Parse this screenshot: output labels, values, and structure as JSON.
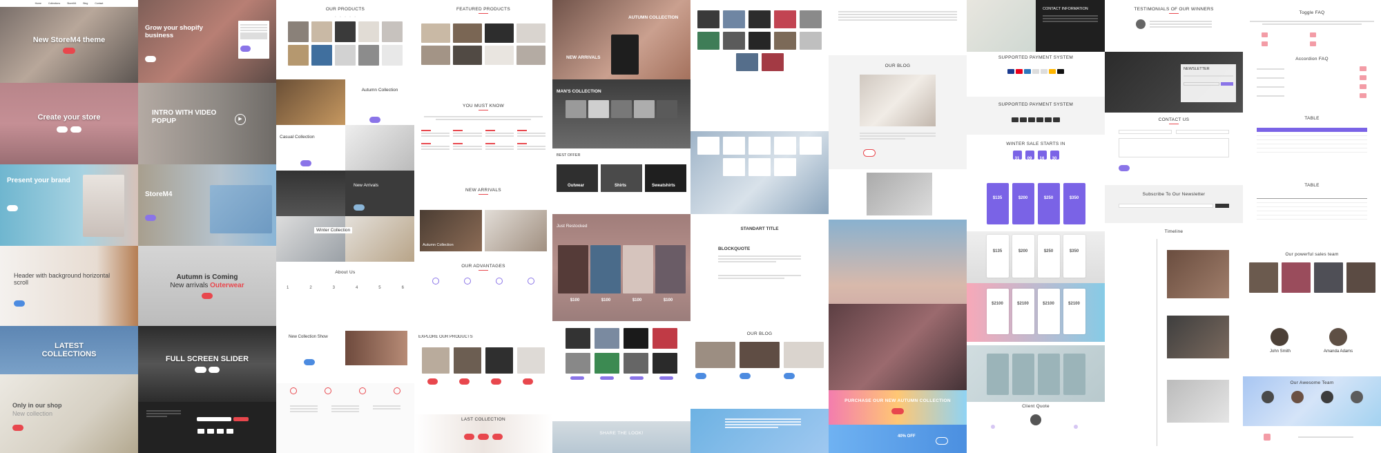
{
  "col1": {
    "nav": [
      "Home",
      "Collections",
      "StoreM4",
      "Blog",
      "Contact"
    ],
    "hero1_title": "New StoreM4 theme",
    "hero2_title": "Create your store",
    "hero3_title": "Present your brand",
    "hero4_title": "Header with background horizontal scroll",
    "hero5_title": "LATEST COLLECTIONS",
    "hero6_title": "Only in our shop",
    "hero6_sub": "New collection"
  },
  "col2": {
    "hero1_title": "Grow your shopify business",
    "hero2_title": "INTRO WITH VIDEO POPUP",
    "hero3_title": "StoreM4",
    "hero4_title": "Autumn is Coming",
    "hero4_sub_a": "New arrivals",
    "hero4_sub_b": "Outerwear",
    "hero5_title": "FULL SCREEN SLIDER"
  },
  "col3": {
    "our_products": "OUR PRODUCTS",
    "autumn": "Autumn Collection",
    "casual": "Casual Collection",
    "new_arrivals": "New Arrivals",
    "winter": "Winter Collection",
    "about": "About Us",
    "about_nums": [
      "1",
      "2",
      "3",
      "4",
      "5",
      "6"
    ],
    "new_show": "New Collection Show"
  },
  "col4": {
    "featured": "FEATURED PRODUCTS",
    "you_must_know": "YOU MUST KNOW",
    "new_arrivals": "NEW ARRIVALS",
    "autumn_collection": "Autumn Collection",
    "advantages": "OUR ADVANTAGES",
    "explore": "EXPLORE OUR PRODUCTS",
    "last": "LAST COLLECTION"
  },
  "col5": {
    "autumn": "AUTUMN COLLECTION",
    "new_arrivals": "NEW ARRIVALS",
    "mans": "MAN'S COLLECTION",
    "best_offer": "BEST OFFER",
    "offer_labels": [
      "Outwear",
      "Shirts",
      "Sweatshirts"
    ],
    "just_restocked": "Just Restocked",
    "prices": [
      "$100",
      "$100",
      "$100",
      "$100"
    ],
    "share": "SHARE THE LOOK!"
  },
  "col6": {
    "standart": "STANDART TITLE",
    "blockquote": "BLOCKQUOTE",
    "blog": "OUR BLOG"
  },
  "col7": {
    "blog": "OUR BLOG",
    "purchase": "PURCHASE OUR NEW AUTUMN COLLECTION",
    "off": "40% OFF"
  },
  "col8": {
    "contact": "CONTACT INFORMATION",
    "payment1": "SUPPORTED PAYMENT SYSTEM",
    "payment2": "SUPPORTED PAYMENT SYSTEM",
    "winter_sale": "WINTER SALE STARTS IN",
    "countdown": [
      "31",
      "09",
      "16",
      "30"
    ],
    "prices_a": [
      "$135",
      "$200",
      "$250",
      "$350"
    ],
    "prices_b": [
      "$135",
      "$200",
      "$250",
      "$350"
    ],
    "prices_c": [
      "$2100",
      "$2100",
      "$2100",
      "$2100"
    ],
    "client_quote": "Client Quote"
  },
  "col9": {
    "testimonials": "TESTIMONIALS OF OUR WINNERS",
    "newsletter": "NEWSLETTER",
    "contact_us": "CONTACT US",
    "subscribe": "Subscribe To Our Newsletter",
    "timeline": "Timeline"
  },
  "col10": {
    "toggle_faq": "Toggle FAQ",
    "accordion_faq": "Accordion FAQ",
    "table1": "TABLE",
    "table2": "TABLE",
    "sales_team": "Our powerful sales team",
    "person1": "John Smith",
    "person2": "Amanda Adams",
    "awesome_team": "Our Awesome Team"
  },
  "colors": {
    "accent_red": "#e8474d",
    "accent_purple": "#7a63e6",
    "accent_blue": "#4c8be0"
  }
}
